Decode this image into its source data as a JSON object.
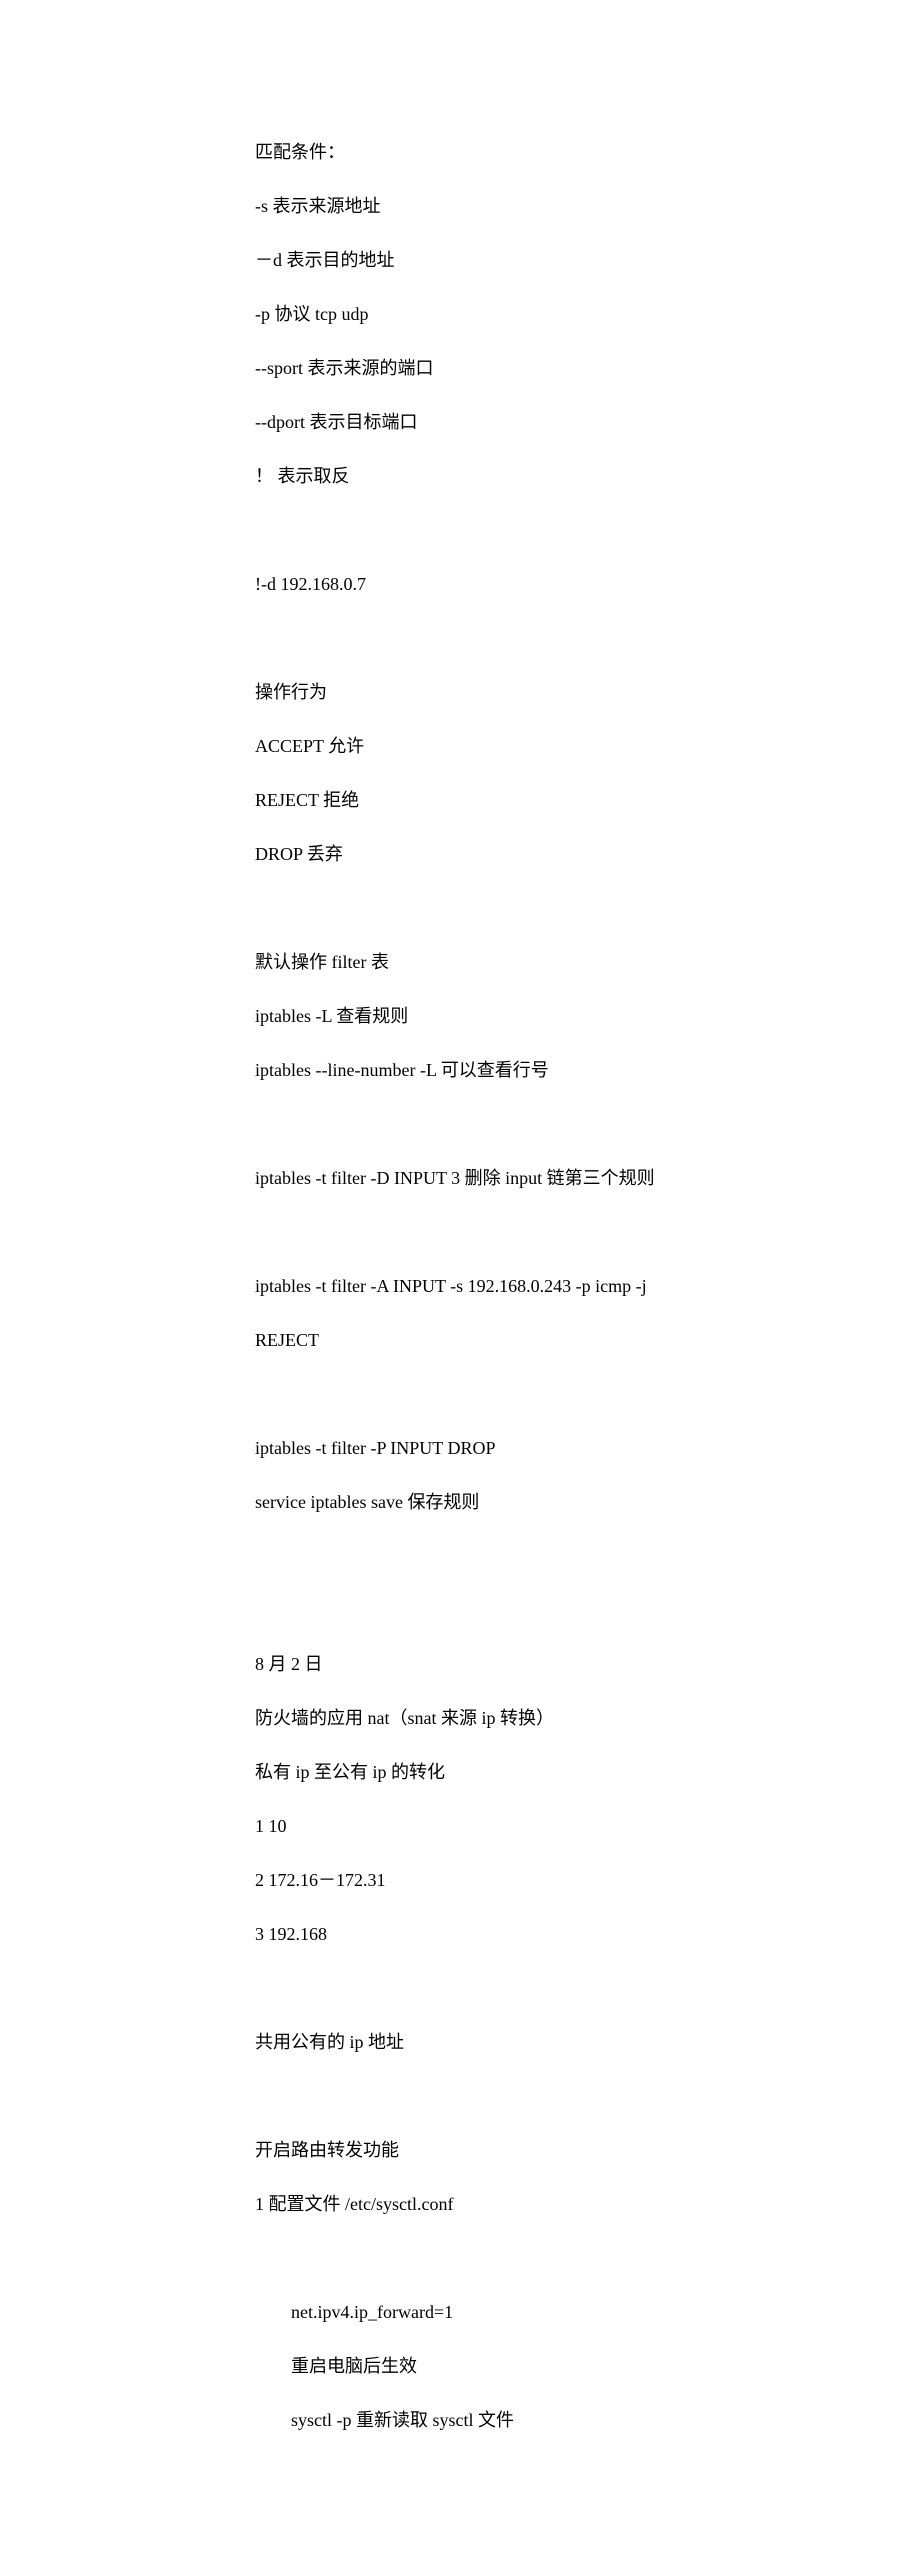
{
  "sections": {
    "matchConditions": {
      "title": "匹配条件：",
      "items": [
        "-s 表示来源地址",
        "－d 表示目的地址",
        "-p 协议 tcp udp",
        "--sport 表示来源的端口",
        "--dport 表示目标端口",
        "！ 表示取反"
      ]
    },
    "example1": "!-d 192.168.0.7",
    "actions": {
      "title": "操作行为",
      "items": [
        "ACCEPT 允许",
        "REJECT 拒绝",
        "DROP 丢弃"
      ]
    },
    "filterTable": {
      "title": "默认操作 filter 表",
      "items": [
        "iptables -L 查看规则",
        "iptables --line-number -L 可以查看行号"
      ]
    },
    "deleteRule": "iptables -t filter -D INPUT 3 删除 input 链第三个规则",
    "addRule": {
      "line1": "iptables -t filter -A INPUT -s 192.168.0.243 -p icmp -j",
      "line2": "REJECT"
    },
    "policyRules": {
      "line1": "iptables -t filter -P INPUT DROP",
      "line2": "service iptables save 保存规则"
    },
    "dateSection": {
      "date": "8 月 2 日",
      "title": "防火墙的应用 nat（snat 来源 ip 转换）",
      "subtitle": "私有 ip 至公有 ip 的转化",
      "items": [
        "1 10",
        "2 172.16－172.31",
        "3 192.168"
      ]
    },
    "sharedIp": "共用公有的 ip 地址",
    "routing": {
      "title": "开启路由转发功能",
      "config": "1 配置文件 /etc/sysctl.conf",
      "items": [
        "net.ipv4.ip_forward=1",
        "重启电脑后生效",
        "sysctl -p 重新读取 sysctl 文件"
      ]
    }
  }
}
